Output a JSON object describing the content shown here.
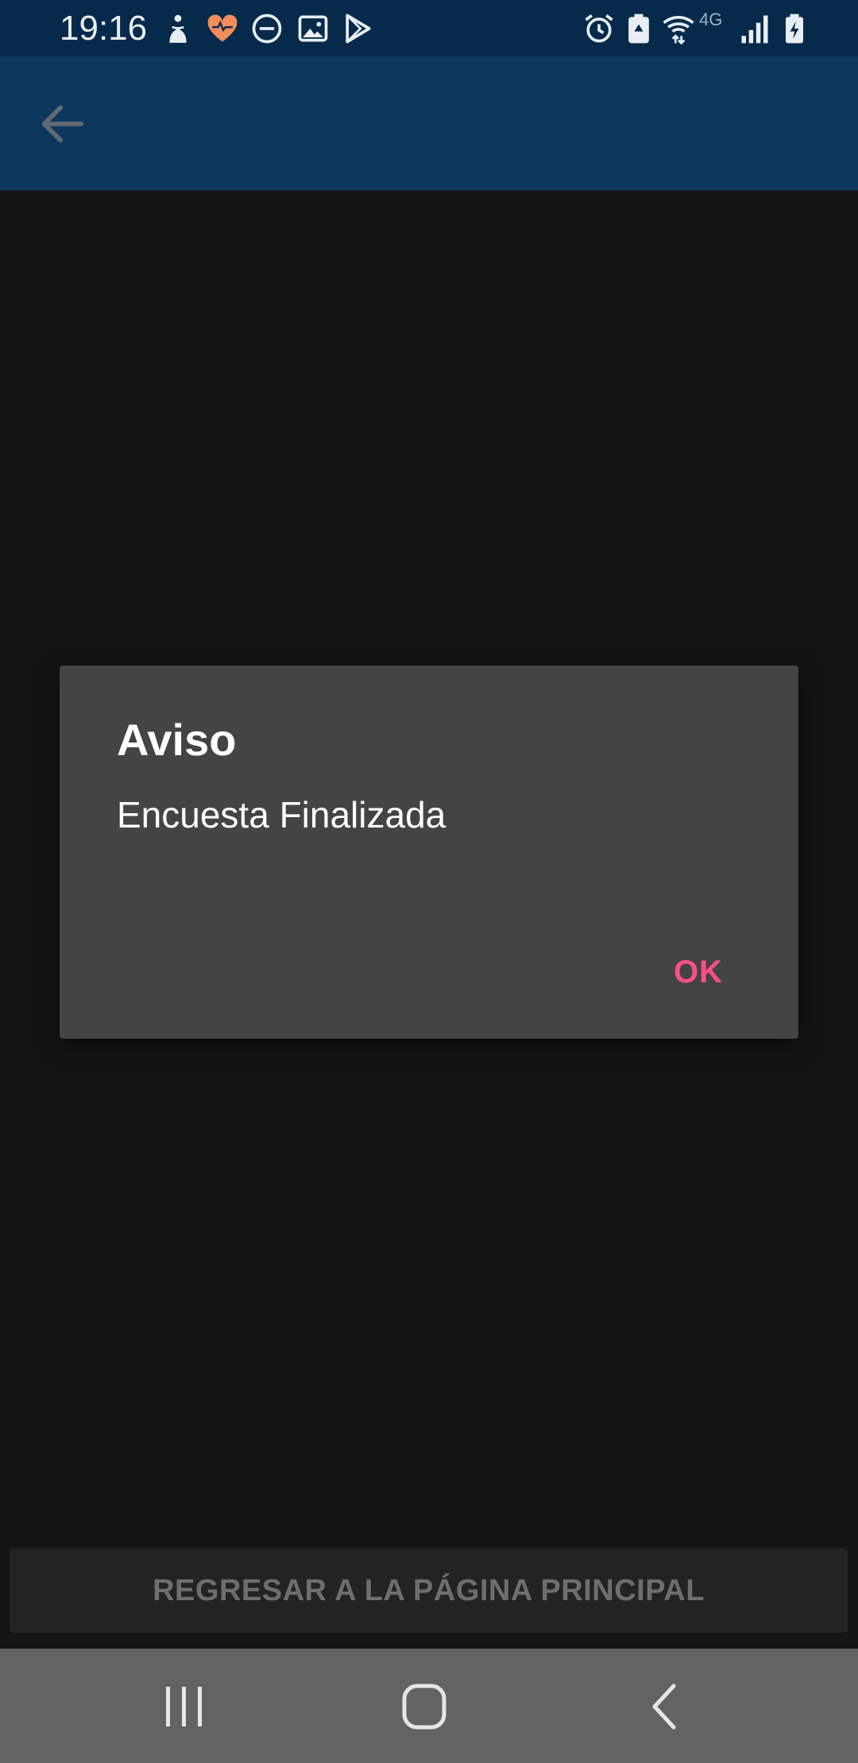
{
  "status_bar": {
    "time": "19:16",
    "network_label": "4G",
    "icons": [
      "accessibility-icon",
      "health-heart-icon",
      "do-not-disturb-icon",
      "gallery-icon",
      "play-store-icon",
      "alarm-icon",
      "battery-saver-icon",
      "wifi-icon",
      "signal-icon",
      "battery-charging-icon"
    ],
    "heart_color": "#f28c5a",
    "background_color": "#072a4a"
  },
  "app_bar": {
    "back_icon": "arrow-left-icon",
    "background_color": "#0d375c"
  },
  "dialog": {
    "title": "Aviso",
    "message": "Encuesta Finalizada",
    "ok_label": "OK",
    "accent_color": "#ff4f8b",
    "background_color": "#444444"
  },
  "bottom_button": {
    "label": "REGRESAR A LA PÁGINA PRINCIPAL"
  },
  "nav_bar": {
    "recents_icon": "recents-icon",
    "home_icon": "home-icon",
    "back_icon": "back-chevron-icon"
  }
}
